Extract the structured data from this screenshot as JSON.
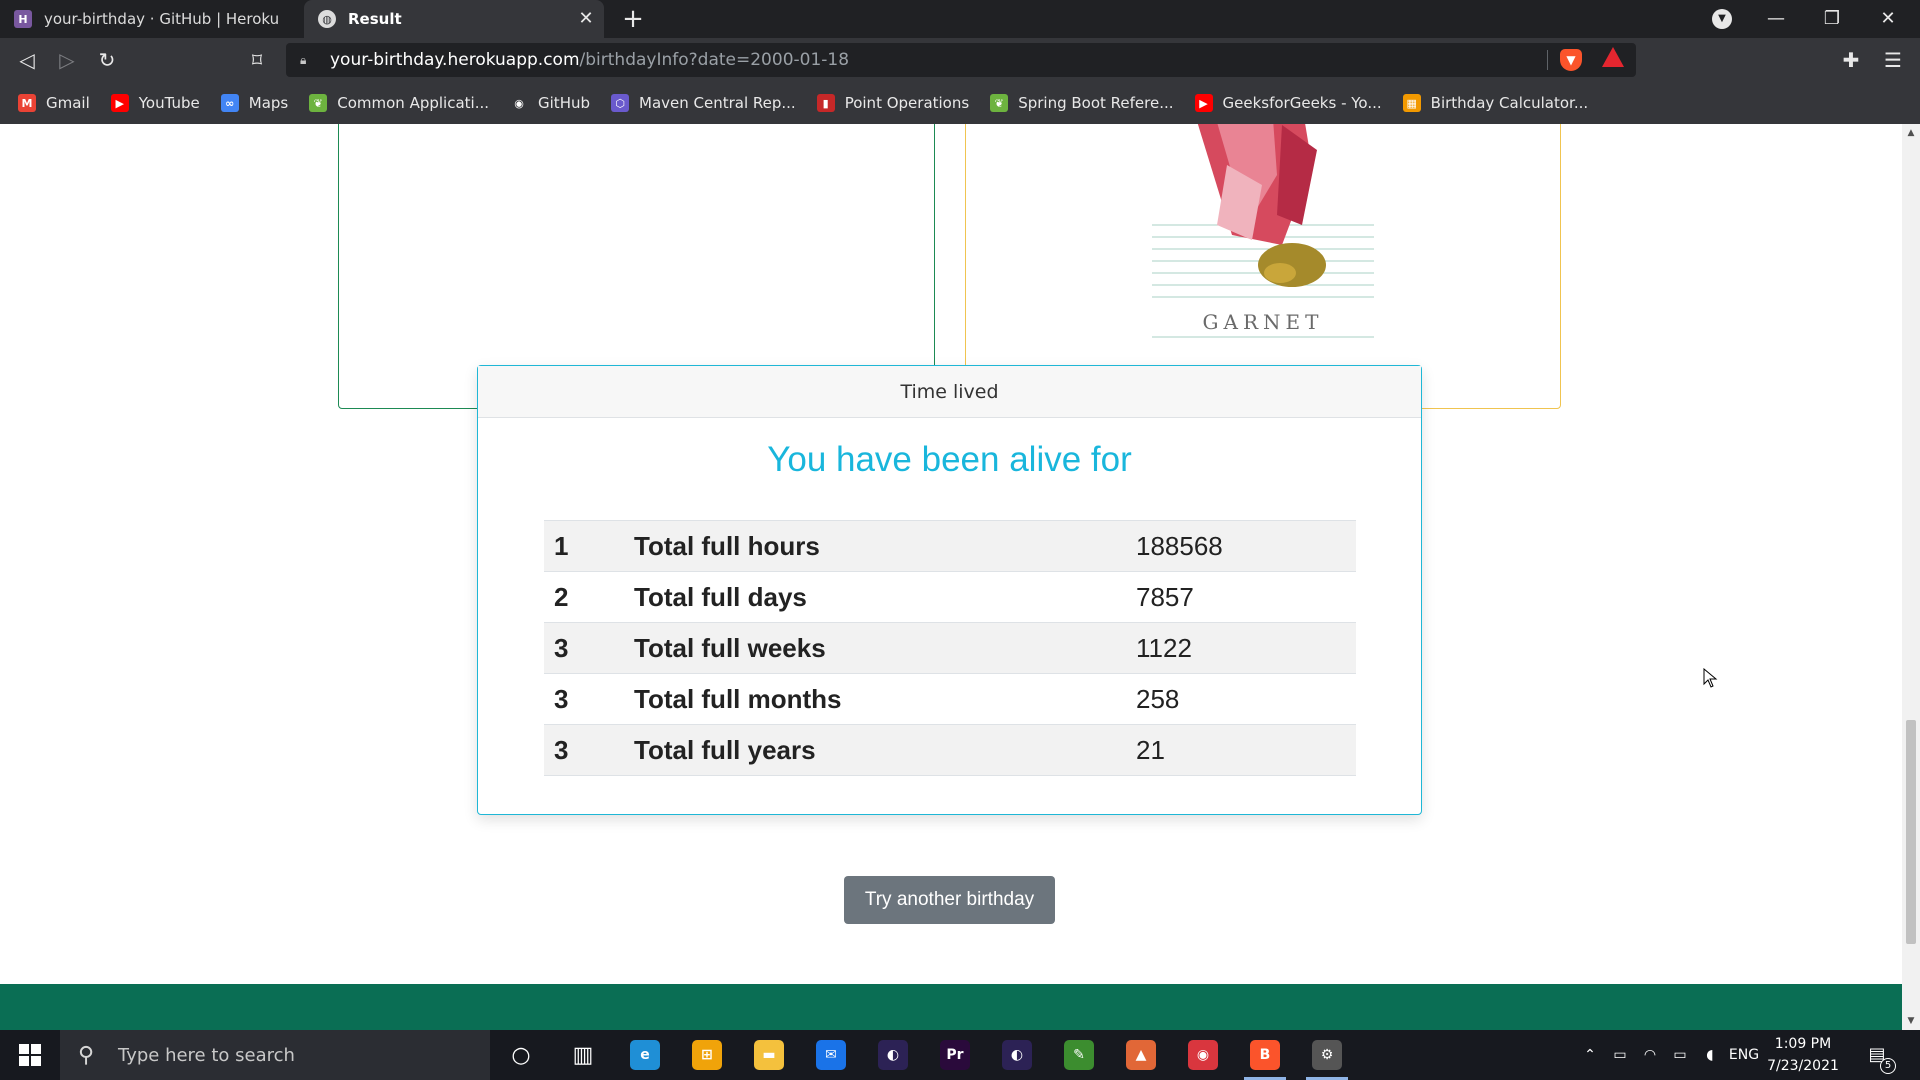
{
  "browser": {
    "tabs": [
      {
        "title": "your-birthday · GitHub | Heroku",
        "icon": "heroku-icon",
        "active": false
      },
      {
        "title": "Result",
        "icon": "globe-icon",
        "active": true
      }
    ],
    "new_tab_label": "+",
    "url_host": "your-birthday.herokuapp.com",
    "url_path": "/birthdayInfo?date=2000-01-18",
    "bookmarks": [
      {
        "label": "Gmail",
        "icon": "gmail-icon",
        "color": "#ea4335",
        "glyph": "M"
      },
      {
        "label": "YouTube",
        "icon": "youtube-icon",
        "color": "#ff0000",
        "glyph": "▶"
      },
      {
        "label": "Maps",
        "icon": "maps-icon",
        "color": "#4285f4",
        "glyph": "∞"
      },
      {
        "label": "Common Applicati...",
        "icon": "spring-leaf-icon",
        "color": "#6db33f",
        "glyph": "❦"
      },
      {
        "label": "GitHub",
        "icon": "github-icon",
        "color": "#35363a",
        "glyph": "◉"
      },
      {
        "label": "Maven Central Rep...",
        "icon": "maven-hexagon-icon",
        "color": "#6a5acd",
        "glyph": "⬡"
      },
      {
        "label": "Point Operations",
        "icon": "point-ops-icon",
        "color": "#c62828",
        "glyph": "▮"
      },
      {
        "label": "Spring Boot Refere...",
        "icon": "spring-leaf-icon",
        "color": "#6db33f",
        "glyph": "❦"
      },
      {
        "label": "GeeksforGeeks - Yo...",
        "icon": "youtube-icon",
        "color": "#ff0000",
        "glyph": "▶"
      },
      {
        "label": "Birthday Calculator...",
        "icon": "calculator-icon",
        "color": "#f29900",
        "glyph": "▦"
      }
    ]
  },
  "page": {
    "gem_label": "GARNET",
    "time_card": {
      "header": "Time lived",
      "title": "You have been alive for",
      "rows": [
        {
          "index": "1",
          "label": "Total full hours",
          "value": "188568"
        },
        {
          "index": "2",
          "label": "Total full days",
          "value": "7857"
        },
        {
          "index": "3",
          "label": "Total full weeks",
          "value": "1122"
        },
        {
          "index": "3",
          "label": "Total full months",
          "value": "258"
        },
        {
          "index": "3",
          "label": "Total full years",
          "value": "21"
        }
      ]
    },
    "try_button": "Try another birthday",
    "colors": {
      "accent_cyan": "#19b6dc",
      "footer_green": "#0a6e54",
      "button_gray": "#6c757d"
    }
  },
  "taskbar": {
    "search_placeholder": "Type here to search",
    "apps": [
      {
        "name": "cortana-icon",
        "glyph": "○",
        "color": "transparent"
      },
      {
        "name": "task-view-icon",
        "glyph": "▥",
        "color": "transparent"
      },
      {
        "name": "edge-icon",
        "glyph": "e",
        "color": "#1f8fd6"
      },
      {
        "name": "store-icon",
        "glyph": "⊞",
        "color": "#f0a30a"
      },
      {
        "name": "file-explorer-icon",
        "glyph": "▬",
        "color": "#f4c13d"
      },
      {
        "name": "mail-icon",
        "glyph": "✉",
        "color": "#1a73e8"
      },
      {
        "name": "eclipse-icon",
        "glyph": "◐",
        "color": "#2c2255"
      },
      {
        "name": "premiere-pro-icon",
        "glyph": "Pr",
        "color": "#2a0a3b"
      },
      {
        "name": "eclipse-icon",
        "glyph": "◐",
        "color": "#2c2255"
      },
      {
        "name": "notepad-icon",
        "glyph": "✎",
        "color": "#3c8d2f"
      },
      {
        "name": "matlab-icon",
        "glyph": "▲",
        "color": "#e16737"
      },
      {
        "name": "record-icon",
        "glyph": "◉",
        "color": "#d9363e"
      },
      {
        "name": "brave-icon",
        "glyph": "B",
        "color": "#fb542b"
      },
      {
        "name": "settings-icon",
        "glyph": "⚙",
        "color": "#555555"
      }
    ],
    "language": "ENG",
    "time": "1:09 PM",
    "date": "7/23/2021",
    "notification_count": "5"
  }
}
